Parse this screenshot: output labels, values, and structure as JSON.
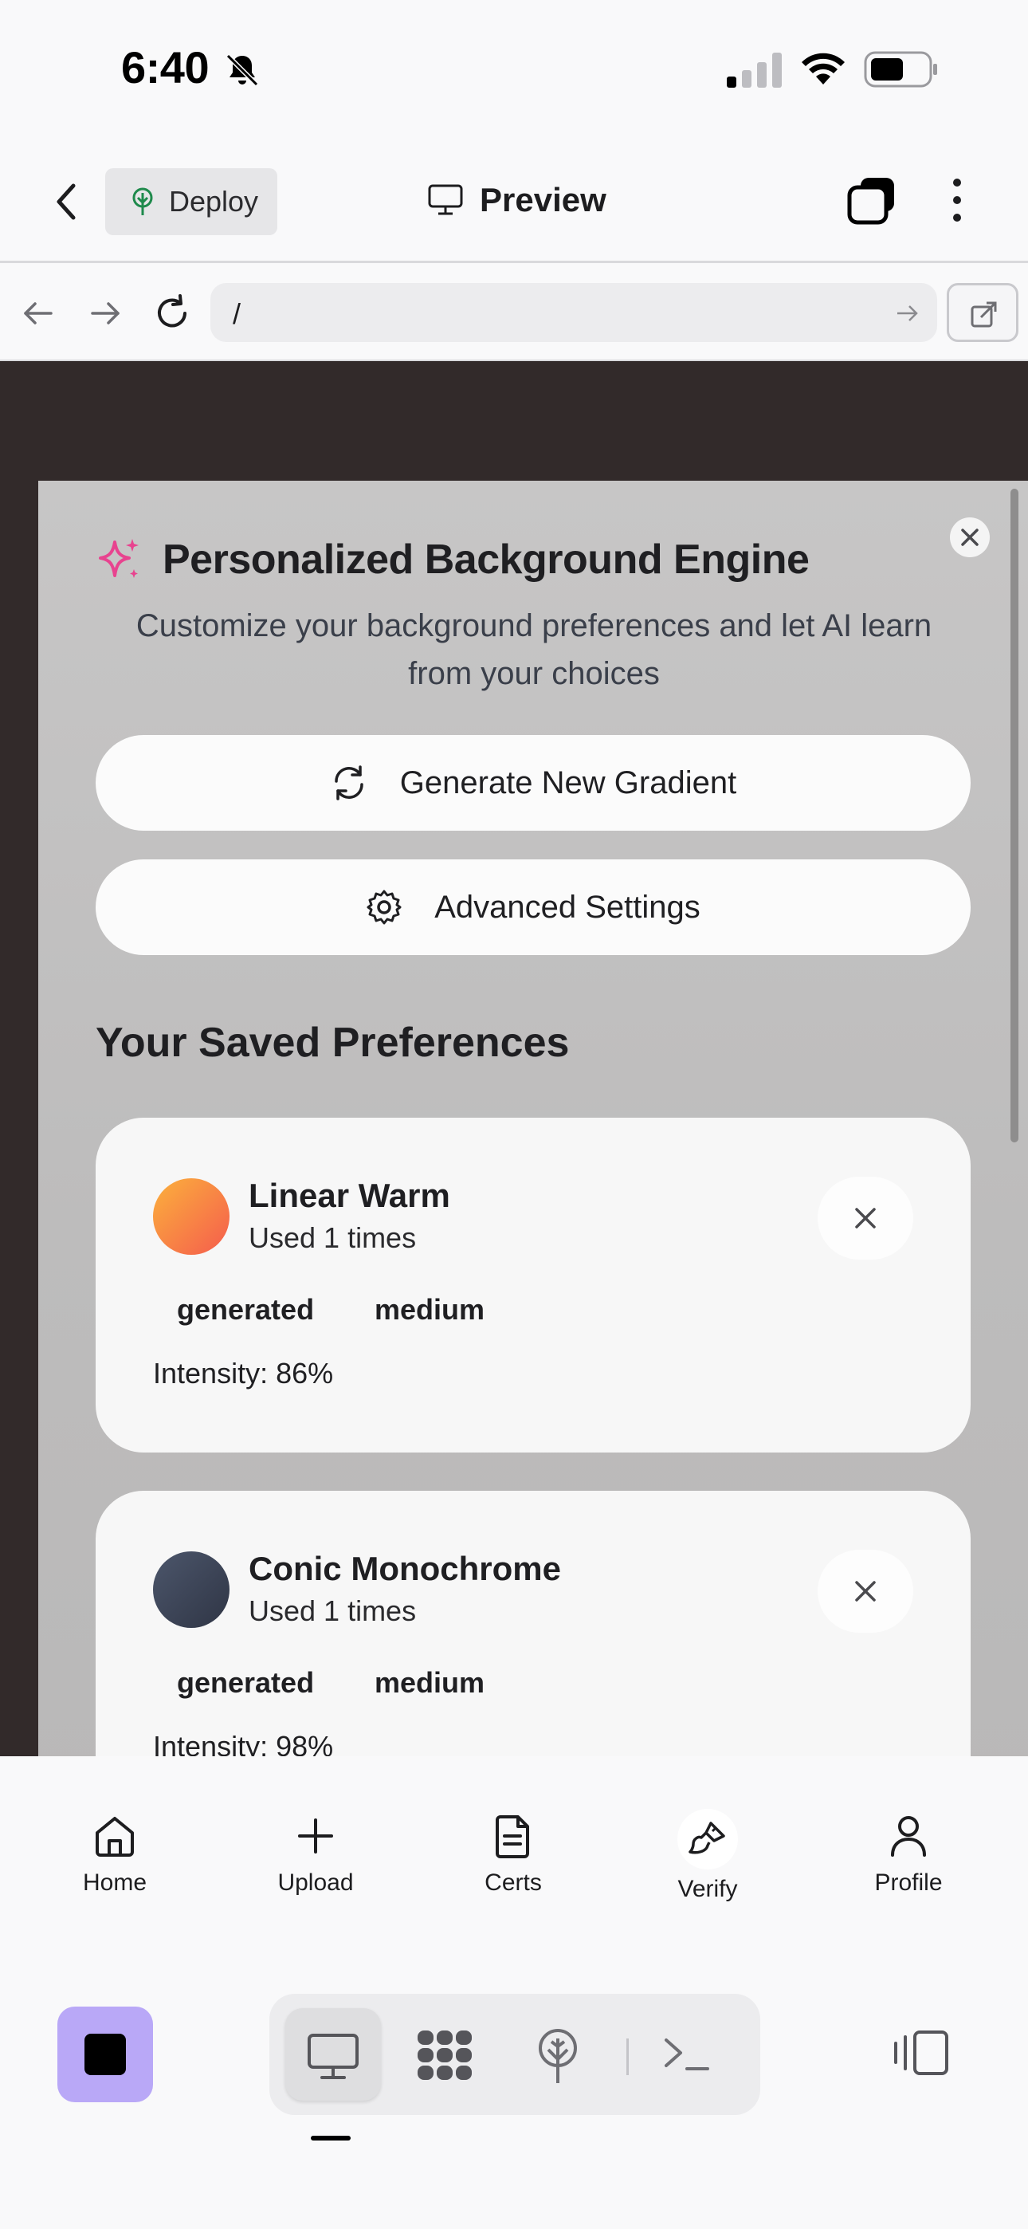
{
  "status_bar": {
    "time": "6:40"
  },
  "app_bar": {
    "deploy_label": "Deploy",
    "title": "Preview"
  },
  "browser": {
    "url": "/"
  },
  "modal": {
    "title": "Personalized Background Engine",
    "subtitle": "Customize your background preferences and let AI learn from your choices",
    "generate_label": "Generate New Gradient",
    "settings_label": "Advanced Settings",
    "saved_heading": "Your Saved Preferences",
    "preferences": [
      {
        "name": "Linear Warm",
        "uses": "Used 1 times",
        "tags": [
          "generated",
          "medium"
        ],
        "intensity": "Intensity: 86%",
        "swatch_colors": [
          "#f9a33a",
          "#f45b4f"
        ]
      },
      {
        "name": "Conic Monochrome",
        "uses": "Used 1 times",
        "tags": [
          "generated",
          "medium"
        ],
        "intensity": "Intensity: 98%",
        "swatch_colors": [
          "#4a5468",
          "#2e3444"
        ]
      }
    ]
  },
  "bottom_nav": {
    "items": [
      {
        "label": "Home",
        "icon": "home-icon"
      },
      {
        "label": "Upload",
        "icon": "plus-icon"
      },
      {
        "label": "Certs",
        "icon": "document-icon"
      },
      {
        "label": "Verify",
        "icon": "brush-icon"
      },
      {
        "label": "Profile",
        "icon": "user-icon"
      }
    ]
  },
  "toolbar": {
    "accent_color": "#b9a8f7"
  }
}
